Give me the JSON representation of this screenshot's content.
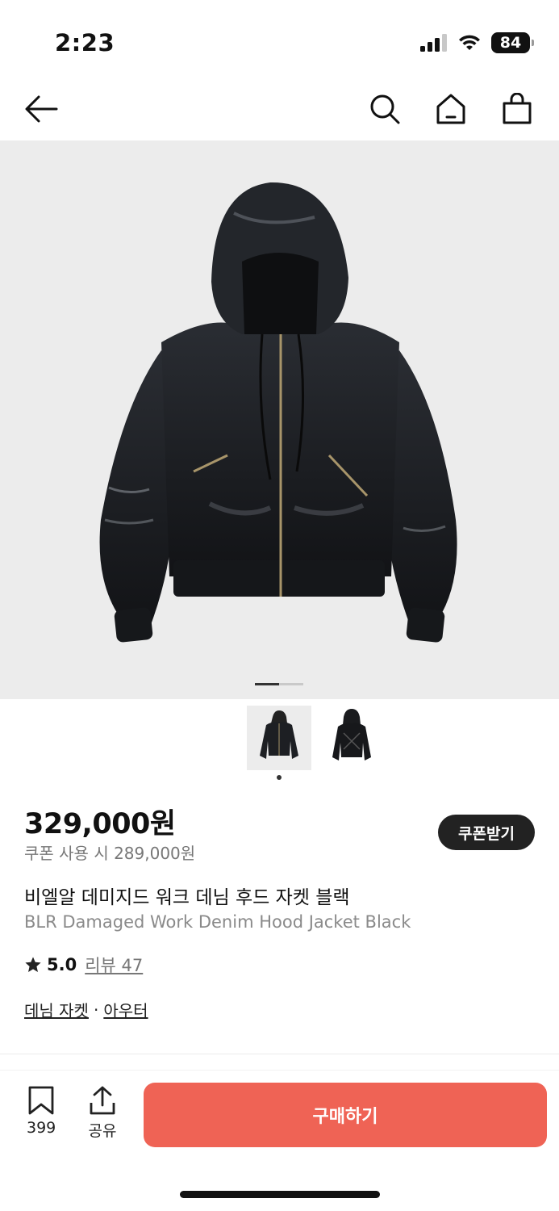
{
  "status_bar": {
    "time": "2:23",
    "battery": "84"
  },
  "nav": {
    "back_icon": "back-arrow-icon",
    "search_icon": "search-icon",
    "home_icon": "home-icon",
    "cart_icon": "shopping-bag-icon"
  },
  "gallery": {
    "current_slide": 1,
    "total_slides": 2,
    "thumbnails": [
      "front-view",
      "back-view"
    ]
  },
  "product": {
    "price": "329,000원",
    "coupon_price": "쿠폰 사용 시 289,000원",
    "coupon_button": "쿠폰받기",
    "title_ko": "비엘알 데미지드 워크 데님 후드 자켓 블랙",
    "title_en": "BLR Damaged Work Denim Hood Jacket Black",
    "rating": "5.0",
    "review_link": "리뷰 47",
    "category_1": "데님 자켓",
    "separator": "·",
    "category_2": "아우터"
  },
  "bottom_bar": {
    "bookmark_count": "399",
    "share_label": "공유",
    "buy_label": "구매하기"
  },
  "colors": {
    "accent": "#ef6355",
    "dark": "#222222",
    "image_bg": "#ececec"
  }
}
